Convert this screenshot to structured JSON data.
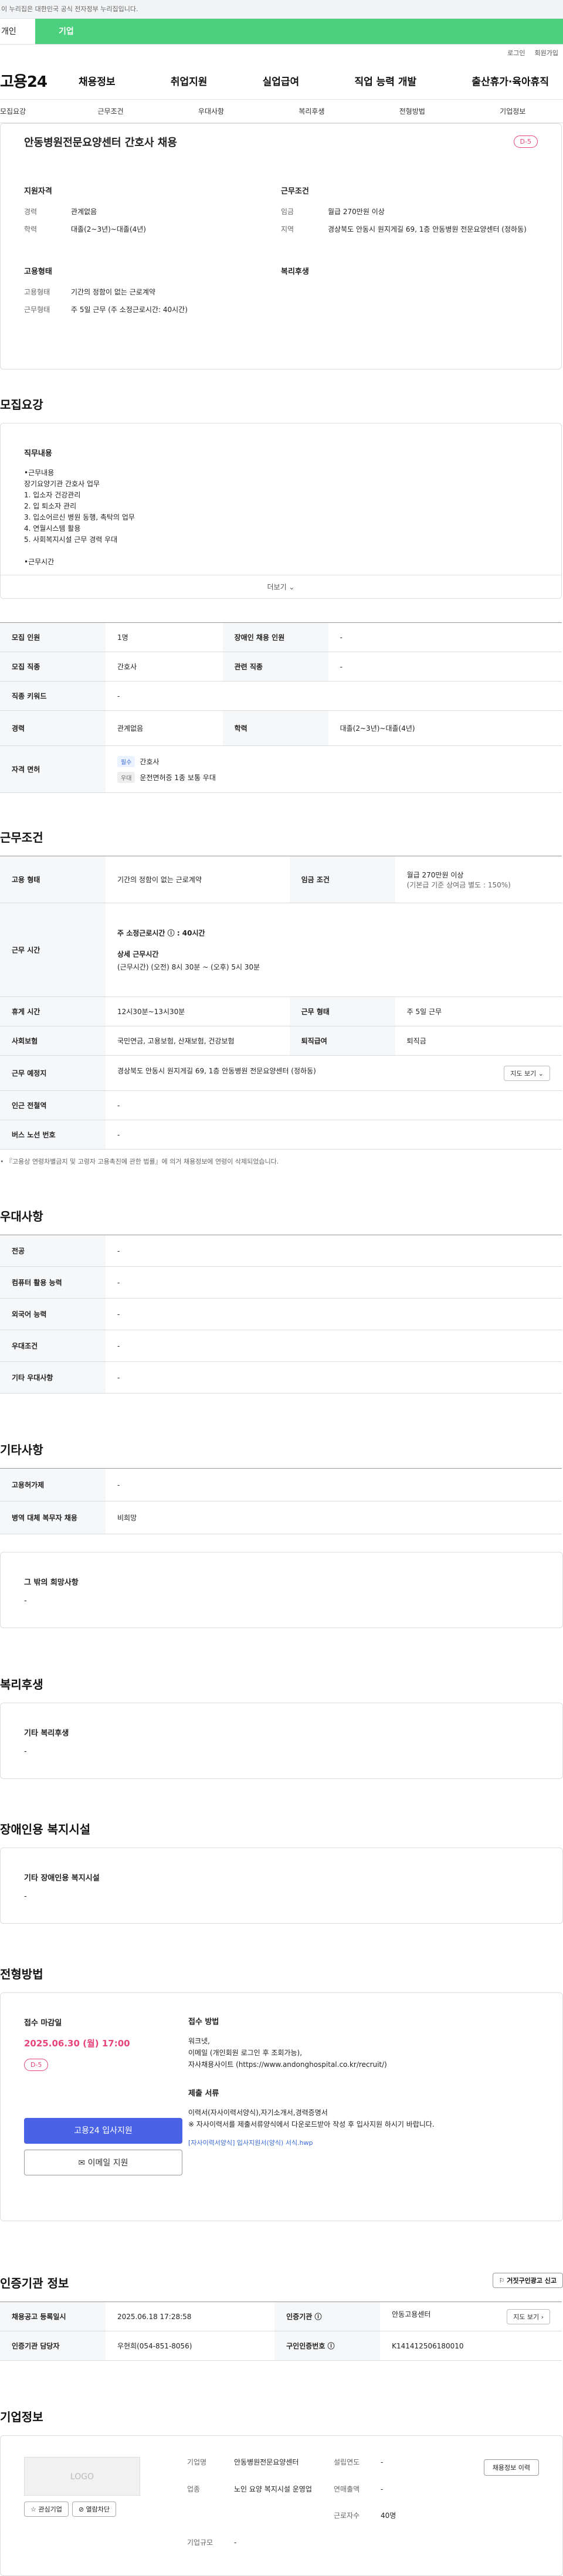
{
  "topbar": "이 누리집은 대한민국 공식 전자정부 누리집입니다.",
  "tabs": [
    "개인",
    "기업"
  ],
  "util": [
    "로그인",
    "회원가입"
  ],
  "logo": "고용24",
  "gnb": [
    "채용정보",
    "취업지원",
    "실업급여",
    "직업 능력 개발",
    "출산휴가·육아휴직"
  ],
  "anchor": [
    "모집요강",
    "근무조건",
    "우대사항",
    "복리후생",
    "전형방법",
    "기업정보"
  ],
  "job": {
    "title": "안동병원전문요양센터 간호사 채용",
    "dday": "D-5",
    "qual_label": "지원자격",
    "cond_label": "근무조건",
    "emp_label": "고용형태",
    "wel_label": "복리후생",
    "qual": [
      {
        "k": "경력",
        "v": "관계없음"
      },
      {
        "k": "학력",
        "v": "대졸(2~3년)~대졸(4년)"
      }
    ],
    "cond": [
      {
        "k": "임금",
        "v": "월급 270만원 이상"
      },
      {
        "k": "지역",
        "v": "경상북도 안동시 원지게길 69, 1층 안동병원 전문요양센터 (정하동)"
      }
    ],
    "emp": [
      {
        "k": "고용형태",
        "v": "기간의 정함이 없는 근로계약"
      },
      {
        "k": "근무형태",
        "v": "주 5일 근무 (주 소정근로시간: 40시간)"
      }
    ]
  },
  "recruit": {
    "h": "모집요강",
    "duty_label": "직무내용",
    "duty": "•근무내용\n장기요양기관 간호사 업무\n1. 입소자 건강관리\n2. 입 퇴소자 관리\n3. 입소어르신 병원 동행, 촉탁의 업무\n4. 연월시스템 활용\n5. 사회복지시설 근무 경력 우대\n\n•근무시간",
    "more": "더보기 ⌄",
    "rows": [
      [
        "모집 인원",
        "1명",
        "장애인 채용 인원",
        "-"
      ],
      [
        "모집 직종",
        "간호사",
        "관련 직종",
        "-"
      ],
      [
        "직종 키워드",
        "-",
        "",
        ""
      ],
      [
        "경력",
        "관계없음",
        "학력",
        "대졸(2~3년)~대졸(4년)"
      ]
    ],
    "license_label": "자격 면허",
    "req": "필수",
    "req_v": "간호사",
    "pref": "우대",
    "pref_v": "운전면허증 1종 보통 우대"
  },
  "work": {
    "h": "근무조건",
    "emp_k": "고용 형태",
    "emp_v": "기간의 정함이 없는 근로계약",
    "wage_k": "임금 조건",
    "wage_v": "월급 270만원 이상",
    "wage_sub": "(기본급 기준 상여금 별도 : 150%)",
    "time_k": "근무 시간",
    "time_v1": "주 소정근로시간 ⓘ : 40시간",
    "time_v2": "상세 근무시간",
    "time_v3": "(근무시간) (오전) 8시 30분 ~ (오후) 5시 30분",
    "rows": [
      [
        "휴게 시간",
        "12시30분~13시30분",
        "근무 형태",
        "주 5일 근무"
      ],
      [
        "사회보험",
        "국민연금, 고용보험, 산재보험, 건강보험",
        "퇴직급여",
        "퇴직금"
      ]
    ],
    "place_k": "근무 예정지",
    "place_v": "경상북도 안동시 원지게길 69, 1층 안동병원 전문요양센터 (정하동)",
    "map": "지도 보기 ⌄",
    "sub_k": "인근 전철역",
    "sub_v": "-",
    "bus_k": "버스 노선 번호",
    "bus_v": "-",
    "note": "• 『고용상 연령차별금지 및 고령자 고용촉진에 관한 법률』에 의거 채용정보에 연령이 삭제되었습니다."
  },
  "pref": {
    "h": "우대사항",
    "rows": [
      [
        "전공",
        "-"
      ],
      [
        "컴퓨터 활용 능력",
        "-"
      ],
      [
        "외국어 능력",
        "-"
      ],
      [
        "우대조건",
        "-"
      ],
      [
        "기타 우대사항",
        "-"
      ]
    ]
  },
  "etc": {
    "h": "기타사항",
    "rows": [
      [
        "고용허가제",
        "-"
      ],
      [
        "병역 대체 복무자 채용",
        "비희망"
      ]
    ],
    "wish_label": "그 밖의 희망사항",
    "wish_v": "-"
  },
  "welfare": {
    "h": "복리후생",
    "label": "기타 복리후생",
    "v": "-"
  },
  "disab": {
    "h": "장애인용 복지시설",
    "label": "기타 장애인용 복지시설",
    "v": "-"
  },
  "select": {
    "h": "전형방법",
    "deadline_label": "접수 마감일",
    "deadline": "2025.06.30 (월) 17:00",
    "dday": "D-5",
    "method_label": "접수 방법",
    "method": "워크넷,\n이메일 (개인회원 로그인 후 조회가능),\n자사채용사이트 (https://www.andonghospital.co.kr/recruit/)",
    "docs_label": "제출 서류",
    "docs": "이력서(자사이력서양식),자기소개서,경력증명서\n※ 자사이력서를 제출서류양식에서 다운로드받아 작성 후 입사지원 하시기 바랍니다.",
    "file": "[자사이력서양식] 입사지원서(양식) 서식.hwp",
    "apply": "고용24 입사지원",
    "email": "✉ 이메일 지원"
  },
  "cert": {
    "h": "인증기관 정보",
    "report": "⚐ 거짓구인광고 신고",
    "rows": [
      [
        "채용공고 등록일시",
        "2025.06.18 17:28:58",
        "인증기관 ⓘ",
        "안동고용센터"
      ],
      [
        "인증기관 담당자",
        "우현희(054-851-8056)",
        "구인인증번호 ⓘ",
        "K141412506180010"
      ]
    ],
    "map": "지도 보기 ›"
  },
  "corp": {
    "h": "기업정보",
    "logo": "LOGO",
    "fav": "☆ 관심기업",
    "block": "⊘ 열람차단",
    "vac": "채용정보 이력",
    "info": [
      [
        "기업명",
        "안동병원전문요양센터",
        "설립연도",
        "-"
      ],
      [
        "업종",
        "노인 요양 복지시설 운영업",
        "연매출액",
        "-"
      ],
      [
        "",
        "",
        "근로자수",
        "40명"
      ],
      [
        "기업규모",
        "-",
        "",
        ""
      ]
    ]
  }
}
